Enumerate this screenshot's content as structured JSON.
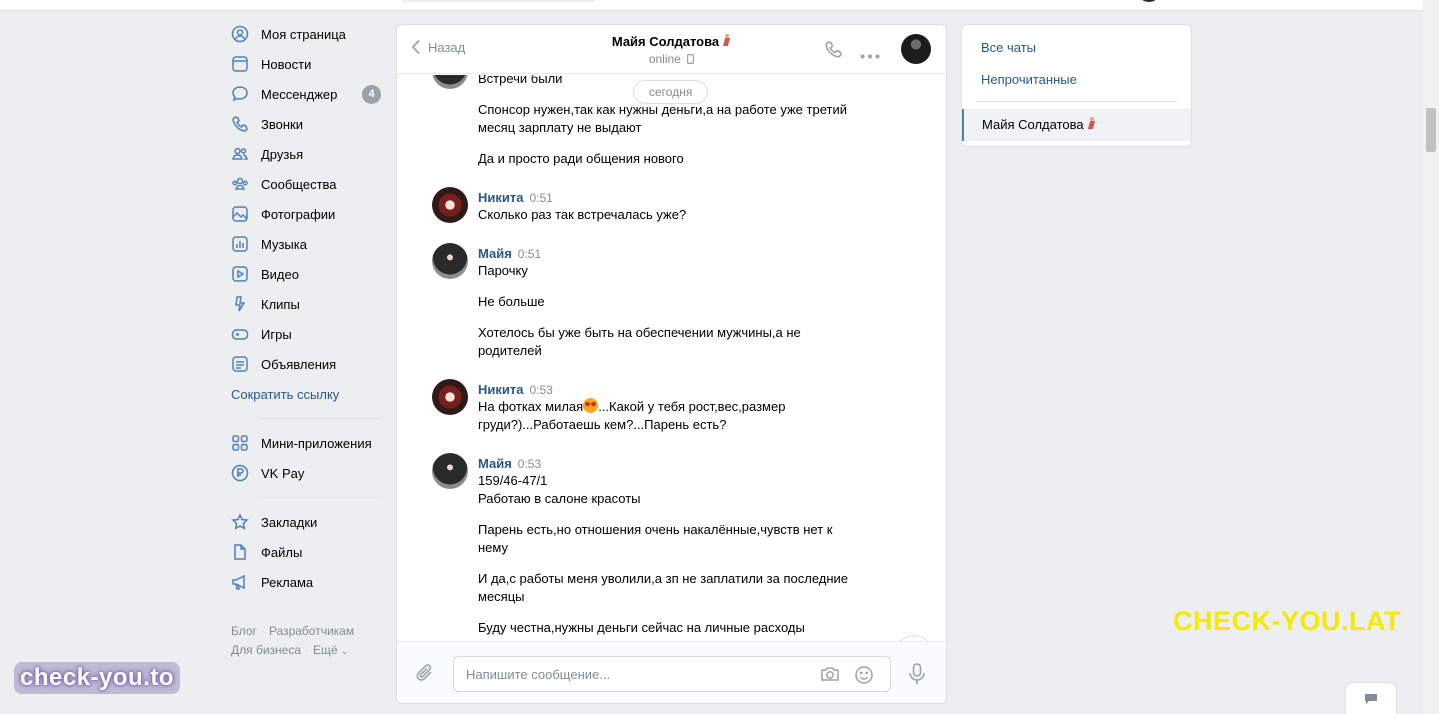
{
  "nav": {
    "items": [
      {
        "label": "Моя страница",
        "icon": "user-circle-icon"
      },
      {
        "label": "Новости",
        "icon": "newspaper-icon"
      },
      {
        "label": "Мессенджер",
        "icon": "message-bubble-icon",
        "badge": "4"
      },
      {
        "label": "Звонки",
        "icon": "phone-icon"
      },
      {
        "label": "Друзья",
        "icon": "friends-icon"
      },
      {
        "label": "Сообщества",
        "icon": "communities-icon"
      },
      {
        "label": "Фотографии",
        "icon": "photo-icon"
      },
      {
        "label": "Музыка",
        "icon": "music-icon"
      },
      {
        "label": "Видео",
        "icon": "video-icon"
      },
      {
        "label": "Клипы",
        "icon": "clips-icon"
      },
      {
        "label": "Игры",
        "icon": "gamepad-icon"
      },
      {
        "label": "Объявления",
        "icon": "classifieds-icon"
      }
    ],
    "short_link": "Сократить ссылку",
    "apps": [
      {
        "label": "Мини-приложения",
        "icon": "mini-apps-icon"
      },
      {
        "label": "VK Pay",
        "icon": "vkpay-icon"
      }
    ],
    "bottom": [
      {
        "label": "Закладки",
        "icon": "star-icon"
      },
      {
        "label": "Файлы",
        "icon": "file-icon"
      },
      {
        "label": "Реклама",
        "icon": "megaphone-icon"
      }
    ],
    "footer": {
      "blog": "Блог",
      "developers": "Разработчикам",
      "business": "Для бизнеса",
      "more": "Ещё"
    }
  },
  "chat": {
    "back_label": "Назад",
    "peer_name": "Майя Солдатова",
    "peer_status": "online",
    "date_divider": "сегодня",
    "messages": {
      "m0": {
        "lines": [
          "Встречи были"
        ]
      },
      "m1": {
        "text": "Спонсор нужен,так как нужны деньги,а на работе уже третий месяц зарплату не выдают"
      },
      "m2": {
        "text": "Да и просто ради общения нового"
      },
      "g1": {
        "author": "Никита",
        "time": "0:51",
        "text": "Сколько раз так встречалась уже?"
      },
      "g2": {
        "author": "Майя",
        "time": "0:51",
        "t1": "Парочку",
        "t2": "Не больше",
        "t3": "Хотелось бы уже быть на обеспечении мужчины,а не родителей"
      },
      "g3": {
        "author": "Никита",
        "time": "0:53",
        "text_a": "На фотках милая",
        "text_b": "...Какой у тебя рост,вес,размер груди?)...Работаешь кем?...Парень есть?"
      },
      "g4": {
        "author": "Майя",
        "time": "0:53",
        "t1": "159/46-47/1",
        "t2": "Работаю в салоне красоты",
        "t3": "Парень есть,но отношения очень накалённые,чувств нет к нему",
        "t4": "И да,с работы меня уволили,а зп не заплатили за последние месяцы",
        "t5": "Буду честна,нужны деньги сейчас на личные расходы"
      }
    },
    "composer_placeholder": "Напишите сообщение..."
  },
  "right_panel": {
    "all_chats": "Все чаты",
    "unread": "Непрочитанные",
    "active_chat": "Майя Солдатова"
  },
  "watermarks": {
    "left": "check-you.to",
    "right": "CHECK-YOU.LAT"
  },
  "colors": {
    "link": "#2a5885",
    "background": "#edeef0",
    "badge": "#99a2ad",
    "accent": "#5181b8",
    "watermark_yellow": "#f5ea00"
  }
}
